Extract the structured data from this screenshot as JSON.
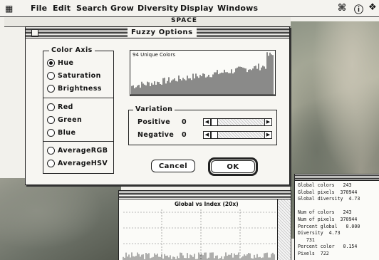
{
  "menubar": {
    "items": [
      "File",
      "Edit",
      "Search",
      "Grow",
      "Diversity",
      "Display",
      "Windows"
    ]
  },
  "back_window": {
    "title": "SPACE"
  },
  "dialog": {
    "title": "Fuzzy Options",
    "color_axis": {
      "legend": "Color Axis",
      "options": [
        "Hue",
        "Saturation",
        "Brightness",
        "Red",
        "Green",
        "Blue",
        "AverageRGB",
        "AverageHSV"
      ],
      "selected": "Hue"
    },
    "histogram": {
      "label": "94 Unique Colors"
    },
    "variation": {
      "legend": "Variation",
      "positive_label": "Positive",
      "positive_value": "0",
      "negative_label": "Negative",
      "negative_value": "0"
    },
    "cancel_label": "Cancel",
    "ok_label": "OK"
  },
  "graph_window": {
    "title": "Global vs Index (20x)"
  },
  "stats": {
    "lines": [
      "Global colors   243",
      "Global pixels  370944",
      "Global diversity  4.73",
      "",
      "Num of colors   243",
      "Num of pixels  370944",
      "Percent global   0.000",
      "Diversity  4.73",
      "   731",
      "Percent color   0.154",
      "Pixels  722"
    ]
  }
}
